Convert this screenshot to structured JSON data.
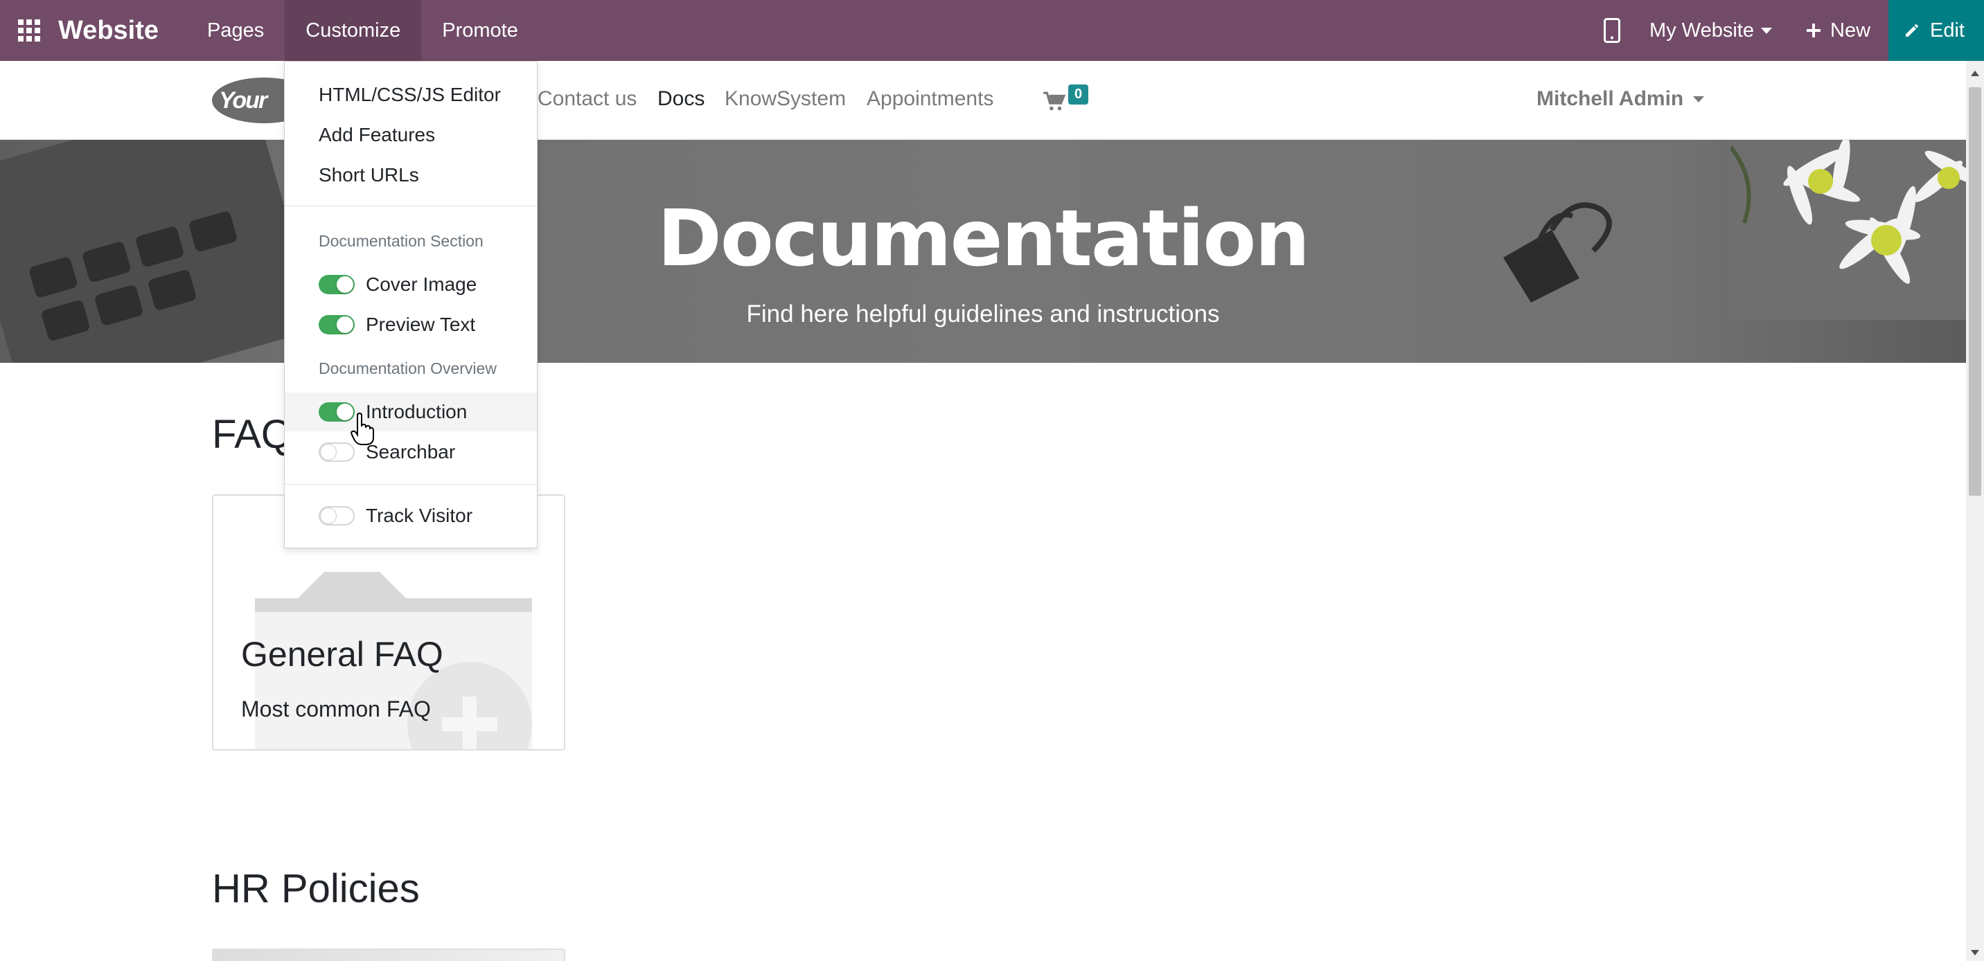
{
  "topbar": {
    "brand": "Website",
    "menu": [
      "Pages",
      "Customize",
      "Promote"
    ],
    "site_switcher": "My Website",
    "new_label": "New",
    "edit_label": "Edit",
    "bg_color": "#714b67",
    "edit_color": "#017e84"
  },
  "site_nav": {
    "logo_text": "Your",
    "links": [
      "Contact us",
      "Docs",
      "KnowSystem",
      "Appointments"
    ],
    "active_link": "Docs",
    "cart_count": "0",
    "user": "Mitchell Admin"
  },
  "hero": {
    "title": "Documentation",
    "subtitle": "Find here helpful guidelines and instructions"
  },
  "sections": [
    {
      "title": "FAQ",
      "cards": [
        {
          "title": "General FAQ",
          "description": "Most common FAQ"
        }
      ]
    },
    {
      "title": "HR Policies"
    }
  ],
  "customize_menu": {
    "items": [
      "HTML/CSS/JS Editor",
      "Add Features",
      "Short URLs"
    ],
    "section_header_1": "Documentation Section",
    "toggles_1": [
      {
        "label": "Cover Image",
        "on": true
      },
      {
        "label": "Preview Text",
        "on": true
      }
    ],
    "section_header_2": "Documentation Overview",
    "toggles_2": [
      {
        "label": "Introduction",
        "on": true
      },
      {
        "label": "Searchbar",
        "on": false
      }
    ],
    "toggles_3": [
      {
        "label": "Track Visitor",
        "on": false
      }
    ]
  }
}
